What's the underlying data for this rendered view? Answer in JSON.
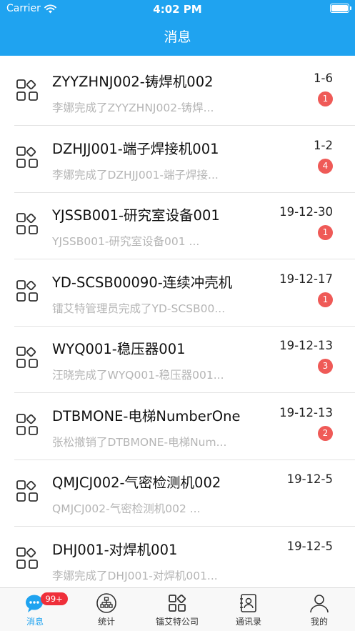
{
  "status_bar": {
    "carrier": "Carrier",
    "time": "4:02 PM"
  },
  "nav": {
    "title": "消息"
  },
  "messages": [
    {
      "title": "ZYYZHNJ002-铸焊机002",
      "subtitle": "李娜完成了ZYYZHNJ002-铸焊...",
      "date": "1-6",
      "unread": "1"
    },
    {
      "title": "DZHJJ001-端子焊接机001",
      "subtitle": "李娜完成了DZHJJ001-端子焊接...",
      "date": "1-2",
      "unread": "4"
    },
    {
      "title": "YJSSB001-研究室设备001",
      "subtitle": "YJSSB001-研究室设备001 ...",
      "date": "19-12-30",
      "unread": "1"
    },
    {
      "title": "YD-SCSB00090-连续冲壳机",
      "subtitle": "镭艾特管理员完成了YD-SCSB00...",
      "date": "19-12-17",
      "unread": "1"
    },
    {
      "title": "WYQ001-稳压器001",
      "subtitle": "汪晓完成了WYQ001-稳压器001...",
      "date": "19-12-13",
      "unread": "3"
    },
    {
      "title": "DTBMONE-电梯NumberOne",
      "subtitle": "张松撤销了DTBMONE-电梯Num...",
      "date": "19-12-13",
      "unread": "2"
    },
    {
      "title": "QMJCJ002-气密检测机002",
      "subtitle": "QMJCJ002-气密检测机002 ...",
      "date": "19-12-5",
      "unread": null
    },
    {
      "title": "DHJ001-对焊机001",
      "subtitle": "李娜完成了DHJ001-对焊机001...",
      "date": "19-12-5",
      "unread": null
    }
  ],
  "tabs": [
    {
      "label": "消息",
      "icon": "chat-bubble-icon",
      "badge": "99+",
      "active": true
    },
    {
      "label": "统计",
      "icon": "org-chart-icon",
      "badge": null,
      "active": false
    },
    {
      "label": "镭艾特公司",
      "icon": "apps-grid-icon",
      "badge": null,
      "active": false
    },
    {
      "label": "通讯录",
      "icon": "contacts-book-icon",
      "badge": null,
      "active": false
    },
    {
      "label": "我的",
      "icon": "person-icon",
      "badge": null,
      "active": false
    }
  ],
  "colors": {
    "accent": "#1fa3f0",
    "badge": "#ef5a57",
    "tab_badge": "#ef2f3a"
  }
}
